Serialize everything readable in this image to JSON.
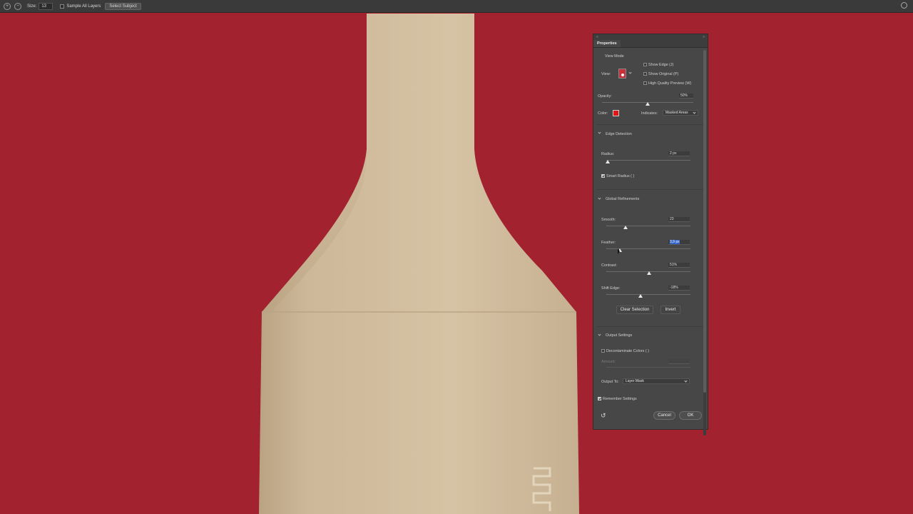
{
  "toolbar": {
    "size_label": "Size:",
    "size_value": "13",
    "sample_all_layers": "Sample All Layers",
    "select_subject": "Select Subject"
  },
  "panel": {
    "tab": "Properties",
    "view_mode": {
      "heading": "View Mode",
      "view_label": "View:",
      "show_edge": "Show Edge (J)",
      "show_original": "Show Original (P)",
      "high_quality": "High Quality Preview (W)"
    },
    "opacity": {
      "label": "Opacity:",
      "value": "50%",
      "level": 0.5
    },
    "color": {
      "label": "Color:",
      "swatch": "#e01616",
      "indicates_label": "Indicates:",
      "indicates_value": "Masked Areas"
    },
    "edge_detection": {
      "heading": "Edge Detection",
      "radius_label": "Radius:",
      "radius_value": "2 px",
      "radius_level": 0.02,
      "smart_radius": "Smart Radius ( )",
      "smart_radius_checked": true
    },
    "global_refinements": {
      "heading": "Global Refinements",
      "smooth_label": "Smooth:",
      "smooth_value": "23",
      "smooth_level": 0.23,
      "feather_label": "Feather:",
      "feather_value": "3,9 px",
      "feather_level": 0.16,
      "contrast_label": "Contrast:",
      "contrast_value": "51%",
      "contrast_level": 0.51,
      "shift_edge_label": "Shift Edge:",
      "shift_edge_value": "-18%",
      "shift_edge_level": 0.41,
      "clear_selection": "Clear Selection",
      "invert": "Invert"
    },
    "output_settings": {
      "heading": "Output Settings",
      "decontaminate": "Decontaminate Colors ( )",
      "amount_label": "Amount:",
      "output_to_label": "Output To:",
      "output_to_value": "Layer Mask"
    },
    "remember_settings": "Remember Settings",
    "cancel": "Cancel",
    "ok": "OK"
  },
  "colors": {
    "background": "#a3222f",
    "vase": "#cdb899",
    "panel": "#474747"
  },
  "icons": [
    "add-brush-icon",
    "subtract-brush-icon",
    "search-icon",
    "reset-icon",
    "collapse-chevron-icon",
    "close-icon"
  ]
}
